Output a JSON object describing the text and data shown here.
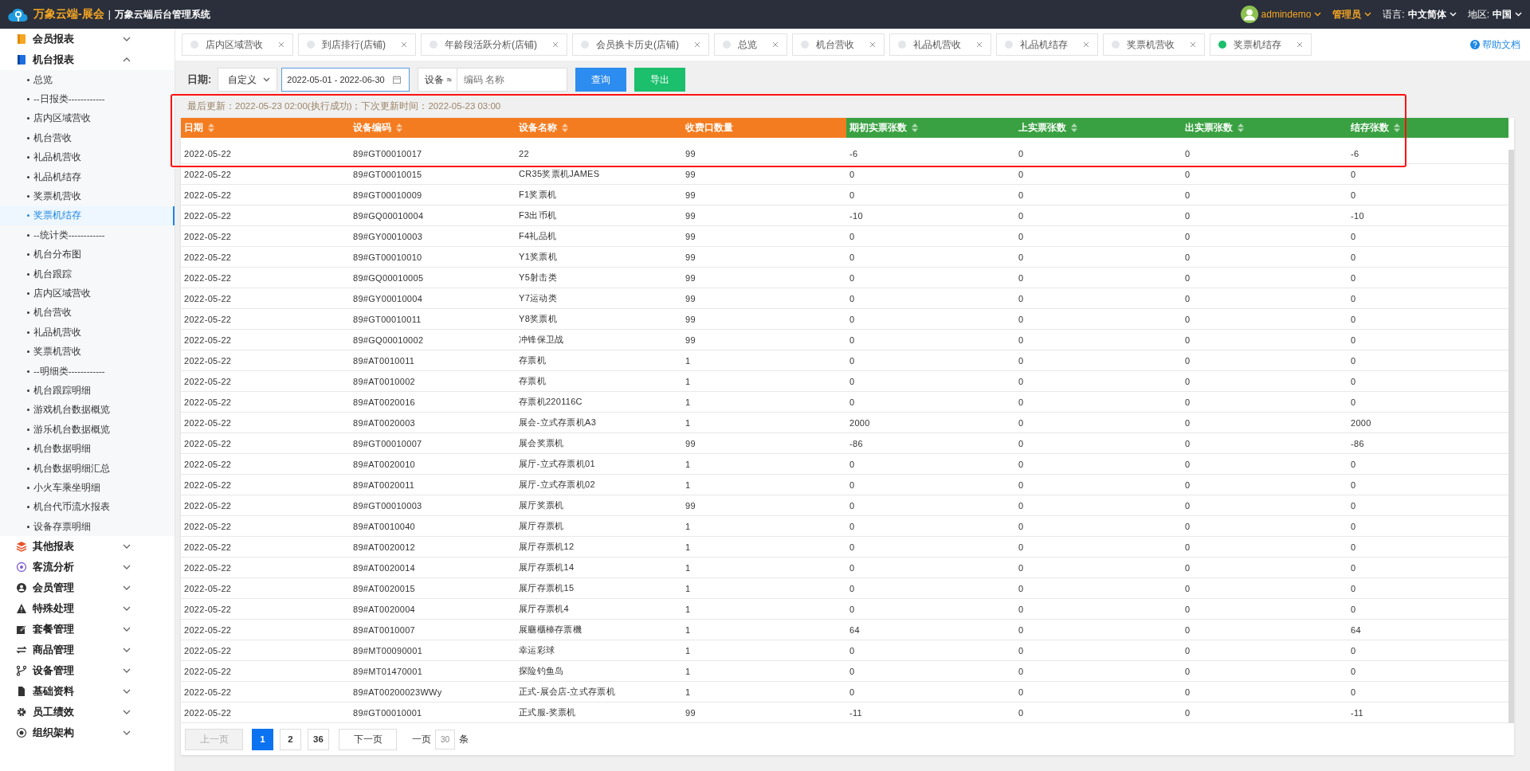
{
  "topbar": {
    "brand": "万象云端-展会",
    "separator": "|",
    "system": "万象云端后台管理系统",
    "user": "admindemo",
    "role": "管理员",
    "language_label": "语言:",
    "language": "中文简体",
    "region_label": "地区:",
    "region": "中国"
  },
  "sidebar": {
    "groups": [
      {
        "label": "会员报表",
        "expanded": false
      },
      {
        "label": "机台报表",
        "expanded": true,
        "children": [
          {
            "label": "总览",
            "selected": false
          },
          {
            "label": "--日报类------------",
            "selected": false
          },
          {
            "label": "店内区域营收",
            "selected": false
          },
          {
            "label": "机台营收",
            "selected": false
          },
          {
            "label": "礼品机营收",
            "selected": false
          },
          {
            "label": "礼品机结存",
            "selected": false
          },
          {
            "label": "奖票机营收",
            "selected": false
          },
          {
            "label": "奖票机结存",
            "selected": true
          },
          {
            "label": "--统计类------------",
            "selected": false
          },
          {
            "label": "机台分布图",
            "selected": false
          },
          {
            "label": "机台跟踪",
            "selected": false
          },
          {
            "label": "店内区域营收",
            "selected": false
          },
          {
            "label": "机台营收",
            "selected": false
          },
          {
            "label": "礼品机营收",
            "selected": false
          },
          {
            "label": "奖票机营收",
            "selected": false
          },
          {
            "label": "--明细类------------",
            "selected": false
          },
          {
            "label": "机台跟踪明细",
            "selected": false
          },
          {
            "label": "游戏机台数据概览",
            "selected": false
          },
          {
            "label": "游乐机台数据概览",
            "selected": false
          },
          {
            "label": "机台数据明细",
            "selected": false
          },
          {
            "label": "机台数据明细汇总",
            "selected": false
          },
          {
            "label": "小火车乘坐明细",
            "selected": false
          },
          {
            "label": "机台代币流水报表",
            "selected": false
          },
          {
            "label": "设备存票明细",
            "selected": false
          }
        ]
      },
      {
        "label": "其他报表",
        "expanded": false
      },
      {
        "label": "客流分析",
        "expanded": false
      },
      {
        "label": "会员管理",
        "expanded": false
      },
      {
        "label": "特殊处理",
        "expanded": false
      },
      {
        "label": "套餐管理",
        "expanded": false
      },
      {
        "label": "商品管理",
        "expanded": false
      },
      {
        "label": "设备管理",
        "expanded": false
      },
      {
        "label": "基础资料",
        "expanded": false
      },
      {
        "label": "员工绩效",
        "expanded": false
      },
      {
        "label": "组织架构",
        "expanded": false
      }
    ]
  },
  "tabs": [
    {
      "label": "店内区域营收",
      "selected": false
    },
    {
      "label": "到店排行(店铺)",
      "selected": false
    },
    {
      "label": "年龄段活跃分析(店铺)",
      "selected": false
    },
    {
      "label": "会员换卡历史(店铺)",
      "selected": false
    },
    {
      "label": "总览",
      "selected": false
    },
    {
      "label": "机台营收",
      "selected": false
    },
    {
      "label": "礼品机营收",
      "selected": false
    },
    {
      "label": "礼品机结存",
      "selected": false
    },
    {
      "label": "奖票机营收",
      "selected": false
    },
    {
      "label": "奖票机结存",
      "selected": true
    }
  ],
  "help": "帮助文档",
  "filter": {
    "date_label": "日期:",
    "range_type": "自定义",
    "date_range": "2022-05-01 - 2022-06-30",
    "device_label": "设备",
    "device_mode": "≈",
    "placeholder": "编码 名称",
    "buttons": [
      {
        "label": "查询",
        "kind": "primary"
      },
      {
        "label": "导出",
        "kind": "success"
      }
    ]
  },
  "info": "最后更新：2022-05-23 02:00(执行成功)；下次更新时间：2022-05-23 03:00",
  "table": {
    "columns": [
      {
        "label": "日期",
        "sortable": true,
        "color": "#f47c20"
      },
      {
        "label": "设备编码",
        "sortable": true,
        "color": "#f47c20"
      },
      {
        "label": "设备名称",
        "sortable": true,
        "color": "#f47c20"
      },
      {
        "label": "收费口数量",
        "sortable": false,
        "color": "#f47c20"
      },
      {
        "label": "期初实票张数",
        "sortable": true,
        "color": "#3aa142"
      },
      {
        "label": "上实票张数",
        "sortable": true,
        "color": "#3aa142"
      },
      {
        "label": "出实票张数",
        "sortable": true,
        "color": "#3aa142"
      },
      {
        "label": "结存张数",
        "sortable": true,
        "color": "#3aa142"
      }
    ],
    "rows": [
      [
        "2022-05-22",
        "89#GT00010017",
        "22",
        "99",
        "-6",
        "0",
        "0",
        "-6"
      ],
      [
        "2022-05-22",
        "89#GT00010015",
        "CR35奖票机JAMES",
        "99",
        "0",
        "0",
        "0",
        "0"
      ],
      [
        "2022-05-22",
        "89#GT00010009",
        "F1奖票机",
        "99",
        "0",
        "0",
        "0",
        "0"
      ],
      [
        "2022-05-22",
        "89#GQ00010004",
        "F3出币机",
        "99",
        "-10",
        "0",
        "0",
        "-10"
      ],
      [
        "2022-05-22",
        "89#GY00010003",
        "F4礼品机",
        "99",
        "0",
        "0",
        "0",
        "0"
      ],
      [
        "2022-05-22",
        "89#GT00010010",
        "Y1奖票机",
        "99",
        "0",
        "0",
        "0",
        "0"
      ],
      [
        "2022-05-22",
        "89#GQ00010005",
        "Y5射击类",
        "99",
        "0",
        "0",
        "0",
        "0"
      ],
      [
        "2022-05-22",
        "89#GY00010004",
        "Y7运动类",
        "99",
        "0",
        "0",
        "0",
        "0"
      ],
      [
        "2022-05-22",
        "89#GT00010011",
        "Y8奖票机",
        "99",
        "0",
        "0",
        "0",
        "0"
      ],
      [
        "2022-05-22",
        "89#GQ00010002",
        "冲锋保卫战",
        "99",
        "0",
        "0",
        "0",
        "0"
      ],
      [
        "2022-05-22",
        "89#AT0010011",
        "存票机",
        "1",
        "0",
        "0",
        "0",
        "0"
      ],
      [
        "2022-05-22",
        "89#AT0010002",
        "存票机",
        "1",
        "0",
        "0",
        "0",
        "0"
      ],
      [
        "2022-05-22",
        "89#AT0020016",
        "存票机220116C",
        "1",
        "0",
        "0",
        "0",
        "0"
      ],
      [
        "2022-05-22",
        "89#AT0020003",
        "展会-立式存票机A3",
        "1",
        "2000",
        "0",
        "0",
        "2000"
      ],
      [
        "2022-05-22",
        "89#GT00010007",
        "展会奖票机",
        "99",
        "-86",
        "0",
        "0",
        "-86"
      ],
      [
        "2022-05-22",
        "89#AT0020010",
        "展厅-立式存票机01",
        "1",
        "0",
        "0",
        "0",
        "0"
      ],
      [
        "2022-05-22",
        "89#AT0020011",
        "展厅-立式存票机02",
        "1",
        "0",
        "0",
        "0",
        "0"
      ],
      [
        "2022-05-22",
        "89#GT00010003",
        "展厅奖票机",
        "99",
        "0",
        "0",
        "0",
        "0"
      ],
      [
        "2022-05-22",
        "89#AT0010040",
        "展厅存票机",
        "1",
        "0",
        "0",
        "0",
        "0"
      ],
      [
        "2022-05-22",
        "89#AT0020012",
        "展厅存票机12",
        "1",
        "0",
        "0",
        "0",
        "0"
      ],
      [
        "2022-05-22",
        "89#AT0020014",
        "展厅存票机14",
        "1",
        "0",
        "0",
        "0",
        "0"
      ],
      [
        "2022-05-22",
        "89#AT0020015",
        "展厅存票机15",
        "1",
        "0",
        "0",
        "0",
        "0"
      ],
      [
        "2022-05-22",
        "89#AT0020004",
        "展厅存票机4",
        "1",
        "0",
        "0",
        "0",
        "0"
      ],
      [
        "2022-05-22",
        "89#AT0010007",
        "展廳櫃檯存票機",
        "1",
        "64",
        "0",
        "0",
        "64"
      ],
      [
        "2022-05-22",
        "89#MT00090001",
        "幸运彩球",
        "1",
        "0",
        "0",
        "0",
        "0"
      ],
      [
        "2022-05-22",
        "89#MT01470001",
        "探险钓鱼岛",
        "1",
        "0",
        "0",
        "0",
        "0"
      ],
      [
        "2022-05-22",
        "89#AT00200023WWy",
        "正式-展会店-立式存票机",
        "1",
        "0",
        "0",
        "0",
        "0"
      ],
      [
        "2022-05-22",
        "89#GT00010001",
        "正式服-奖票机",
        "99",
        "-11",
        "0",
        "0",
        "-11"
      ]
    ]
  },
  "pagination": {
    "prev": {
      "label": "上一页",
      "disabled": true
    },
    "pages": [
      {
        "label": "1",
        "selected": true
      },
      {
        "label": "2",
        "selected": false
      },
      {
        "label": "36",
        "selected": false
      }
    ],
    "next": {
      "label": "下一页",
      "disabled": false
    },
    "per_page_label": "一页",
    "per_page": "30",
    "unit": "条"
  }
}
